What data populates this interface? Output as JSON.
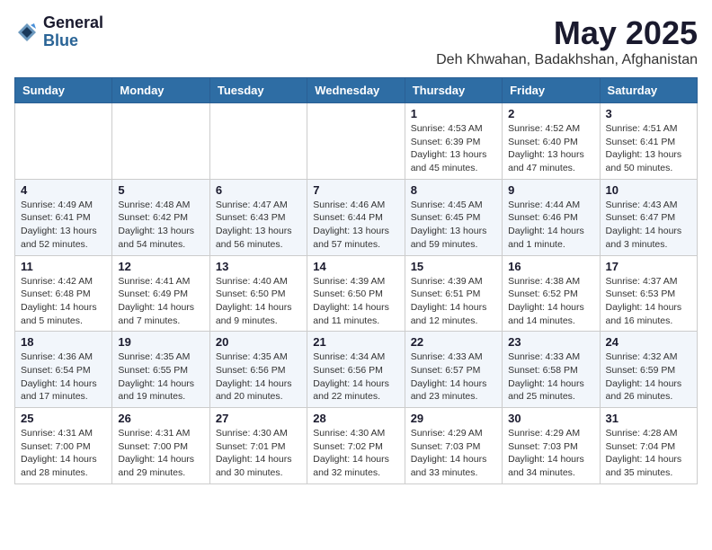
{
  "logo": {
    "general": "General",
    "blue": "Blue"
  },
  "title": "May 2025",
  "location": "Deh Khwahan, Badakhshan, Afghanistan",
  "weekdays": [
    "Sunday",
    "Monday",
    "Tuesday",
    "Wednesday",
    "Thursday",
    "Friday",
    "Saturday"
  ],
  "weeks": [
    [
      {
        "day": "",
        "info": ""
      },
      {
        "day": "",
        "info": ""
      },
      {
        "day": "",
        "info": ""
      },
      {
        "day": "",
        "info": ""
      },
      {
        "day": "1",
        "info": "Sunrise: 4:53 AM\nSunset: 6:39 PM\nDaylight: 13 hours\nand 45 minutes."
      },
      {
        "day": "2",
        "info": "Sunrise: 4:52 AM\nSunset: 6:40 PM\nDaylight: 13 hours\nand 47 minutes."
      },
      {
        "day": "3",
        "info": "Sunrise: 4:51 AM\nSunset: 6:41 PM\nDaylight: 13 hours\nand 50 minutes."
      }
    ],
    [
      {
        "day": "4",
        "info": "Sunrise: 4:49 AM\nSunset: 6:41 PM\nDaylight: 13 hours\nand 52 minutes."
      },
      {
        "day": "5",
        "info": "Sunrise: 4:48 AM\nSunset: 6:42 PM\nDaylight: 13 hours\nand 54 minutes."
      },
      {
        "day": "6",
        "info": "Sunrise: 4:47 AM\nSunset: 6:43 PM\nDaylight: 13 hours\nand 56 minutes."
      },
      {
        "day": "7",
        "info": "Sunrise: 4:46 AM\nSunset: 6:44 PM\nDaylight: 13 hours\nand 57 minutes."
      },
      {
        "day": "8",
        "info": "Sunrise: 4:45 AM\nSunset: 6:45 PM\nDaylight: 13 hours\nand 59 minutes."
      },
      {
        "day": "9",
        "info": "Sunrise: 4:44 AM\nSunset: 6:46 PM\nDaylight: 14 hours\nand 1 minute."
      },
      {
        "day": "10",
        "info": "Sunrise: 4:43 AM\nSunset: 6:47 PM\nDaylight: 14 hours\nand 3 minutes."
      }
    ],
    [
      {
        "day": "11",
        "info": "Sunrise: 4:42 AM\nSunset: 6:48 PM\nDaylight: 14 hours\nand 5 minutes."
      },
      {
        "day": "12",
        "info": "Sunrise: 4:41 AM\nSunset: 6:49 PM\nDaylight: 14 hours\nand 7 minutes."
      },
      {
        "day": "13",
        "info": "Sunrise: 4:40 AM\nSunset: 6:50 PM\nDaylight: 14 hours\nand 9 minutes."
      },
      {
        "day": "14",
        "info": "Sunrise: 4:39 AM\nSunset: 6:50 PM\nDaylight: 14 hours\nand 11 minutes."
      },
      {
        "day": "15",
        "info": "Sunrise: 4:39 AM\nSunset: 6:51 PM\nDaylight: 14 hours\nand 12 minutes."
      },
      {
        "day": "16",
        "info": "Sunrise: 4:38 AM\nSunset: 6:52 PM\nDaylight: 14 hours\nand 14 minutes."
      },
      {
        "day": "17",
        "info": "Sunrise: 4:37 AM\nSunset: 6:53 PM\nDaylight: 14 hours\nand 16 minutes."
      }
    ],
    [
      {
        "day": "18",
        "info": "Sunrise: 4:36 AM\nSunset: 6:54 PM\nDaylight: 14 hours\nand 17 minutes."
      },
      {
        "day": "19",
        "info": "Sunrise: 4:35 AM\nSunset: 6:55 PM\nDaylight: 14 hours\nand 19 minutes."
      },
      {
        "day": "20",
        "info": "Sunrise: 4:35 AM\nSunset: 6:56 PM\nDaylight: 14 hours\nand 20 minutes."
      },
      {
        "day": "21",
        "info": "Sunrise: 4:34 AM\nSunset: 6:56 PM\nDaylight: 14 hours\nand 22 minutes."
      },
      {
        "day": "22",
        "info": "Sunrise: 4:33 AM\nSunset: 6:57 PM\nDaylight: 14 hours\nand 23 minutes."
      },
      {
        "day": "23",
        "info": "Sunrise: 4:33 AM\nSunset: 6:58 PM\nDaylight: 14 hours\nand 25 minutes."
      },
      {
        "day": "24",
        "info": "Sunrise: 4:32 AM\nSunset: 6:59 PM\nDaylight: 14 hours\nand 26 minutes."
      }
    ],
    [
      {
        "day": "25",
        "info": "Sunrise: 4:31 AM\nSunset: 7:00 PM\nDaylight: 14 hours\nand 28 minutes."
      },
      {
        "day": "26",
        "info": "Sunrise: 4:31 AM\nSunset: 7:00 PM\nDaylight: 14 hours\nand 29 minutes."
      },
      {
        "day": "27",
        "info": "Sunrise: 4:30 AM\nSunset: 7:01 PM\nDaylight: 14 hours\nand 30 minutes."
      },
      {
        "day": "28",
        "info": "Sunrise: 4:30 AM\nSunset: 7:02 PM\nDaylight: 14 hours\nand 32 minutes."
      },
      {
        "day": "29",
        "info": "Sunrise: 4:29 AM\nSunset: 7:03 PM\nDaylight: 14 hours\nand 33 minutes."
      },
      {
        "day": "30",
        "info": "Sunrise: 4:29 AM\nSunset: 7:03 PM\nDaylight: 14 hours\nand 34 minutes."
      },
      {
        "day": "31",
        "info": "Sunrise: 4:28 AM\nSunset: 7:04 PM\nDaylight: 14 hours\nand 35 minutes."
      }
    ]
  ]
}
